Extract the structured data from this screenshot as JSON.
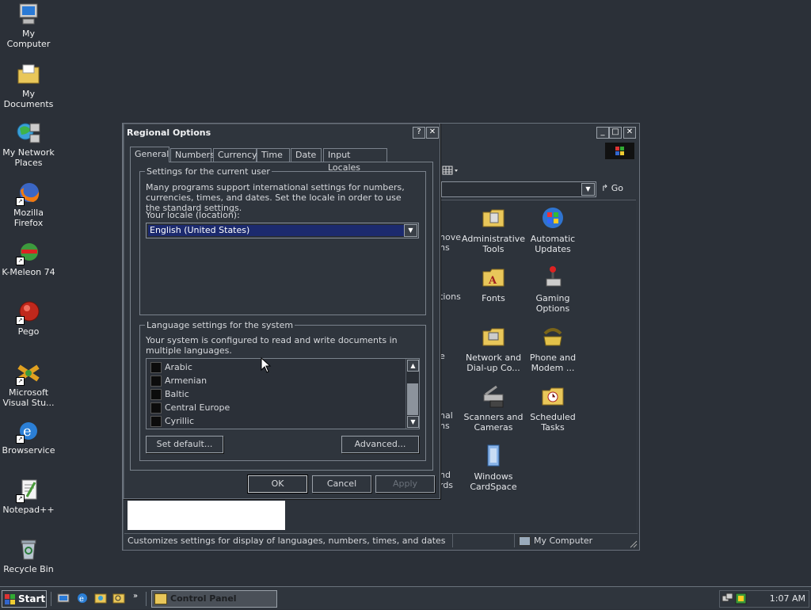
{
  "desktop_icons": [
    {
      "label": "My Computer",
      "icon": "my-computer-icon"
    },
    {
      "label": "My Documents",
      "icon": "my-documents-icon"
    },
    {
      "label": "My Network Places",
      "icon": "network-places-icon"
    },
    {
      "label": "Mozilla Firefox",
      "icon": "firefox-icon"
    },
    {
      "label": "K-Meleon 74",
      "icon": "k-meleon-icon"
    },
    {
      "label": "Pego",
      "icon": "pego-icon"
    },
    {
      "label": "Microsoft Visual Stu...",
      "icon": "visual-studio-icon"
    },
    {
      "label": "Browservice",
      "icon": "browservice-icon"
    },
    {
      "label": "Notepad++",
      "icon": "notepadpp-icon"
    },
    {
      "label": "Recycle Bin",
      "icon": "recycle-bin-icon"
    }
  ],
  "control_panel": {
    "address_go": "Go",
    "items": [
      {
        "label": "Administrative Tools",
        "icon": "administrative-tools-icon"
      },
      {
        "label": "Automatic Updates",
        "icon": "automatic-updates-icon"
      },
      {
        "label": "Fonts",
        "icon": "fonts-icon"
      },
      {
        "label": "Gaming Options",
        "icon": "gaming-options-icon"
      },
      {
        "label": "Network and Dial-up Co...",
        "icon": "network-dialup-icon"
      },
      {
        "label": "Phone and Modem ...",
        "icon": "phone-modem-icon"
      },
      {
        "label": "Scanners and Cameras",
        "icon": "scanners-cameras-icon"
      },
      {
        "label": "Scheduled Tasks",
        "icon": "scheduled-tasks-icon"
      },
      {
        "label": "Windows CardSpace",
        "icon": "cardspace-icon"
      }
    ],
    "partial_labels": [
      "nove",
      "ns",
      "tions",
      "e",
      "nal",
      "ns",
      "nd",
      "rds"
    ],
    "status_text": "Customizes settings for display of languages, numbers, times, and dates",
    "status_zone": "My Computer"
  },
  "dialog": {
    "title": "Regional Options",
    "help_btn": "?",
    "close_btn": "✕",
    "tabs": [
      "General",
      "Numbers",
      "Currency",
      "Time",
      "Date",
      "Input Locales"
    ],
    "user_group": {
      "legend": "Settings for the current user",
      "description": "Many programs support international settings for numbers, currencies, times, and dates. Set the locale in order to use the standard settings.",
      "locale_label": "Your locale (location):",
      "locale_value": "English (United States)"
    },
    "system_group": {
      "legend": "Language settings for the system",
      "description": "Your system is configured to read and write documents in multiple languages.",
      "languages": [
        "Arabic",
        "Armenian",
        "Baltic",
        "Central Europe",
        "Cyrillic"
      ],
      "set_default": "Set default...",
      "advanced": "Advanced..."
    },
    "ok": "OK",
    "cancel": "Cancel",
    "apply": "Apply"
  },
  "taskbar": {
    "start": "Start",
    "task": "Control Panel",
    "time": "1:07 AM"
  }
}
